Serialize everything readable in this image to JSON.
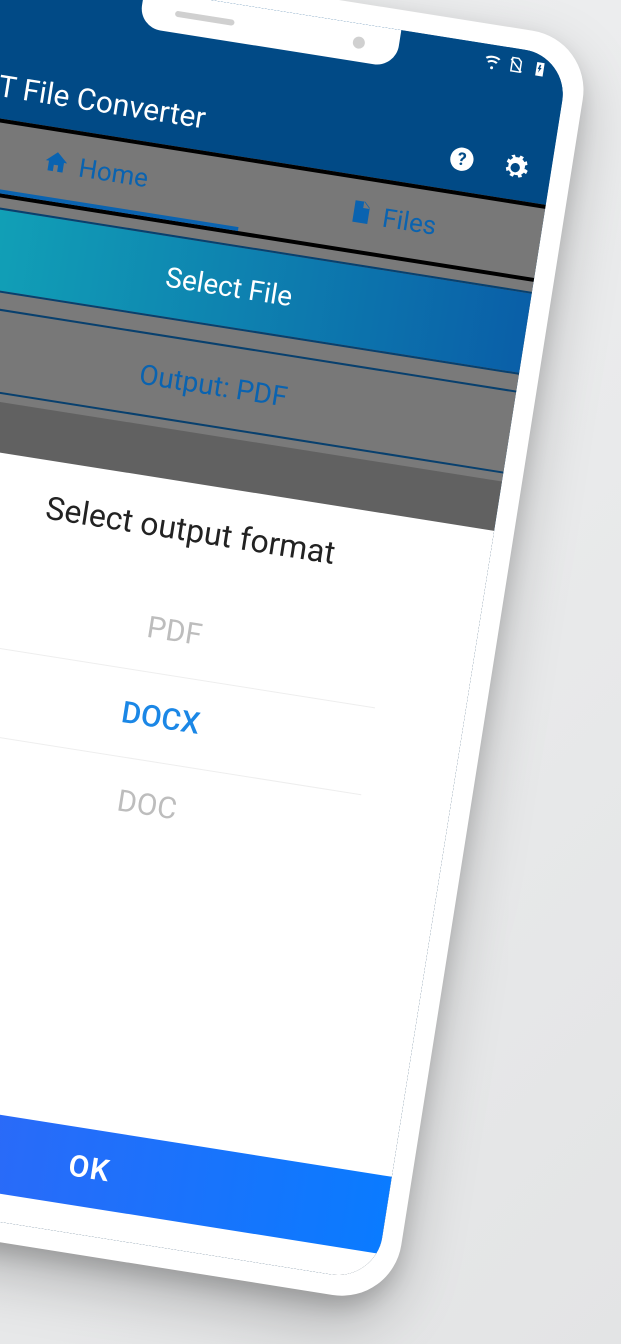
{
  "status": {
    "wifi": true,
    "battery_charging": true,
    "signal_off": true
  },
  "appbar": {
    "title": "PT File Converter",
    "help_icon": "help-icon",
    "settings_icon": "settings-icon"
  },
  "tabs": [
    {
      "label": "Home",
      "icon": "home-icon",
      "active": true
    },
    {
      "label": "Files",
      "icon": "file-icon",
      "active": false
    }
  ],
  "buttons": {
    "select_file": "Select File",
    "output": "Output: PDF"
  },
  "dialog": {
    "title": "Select output format",
    "options": [
      "PDF",
      "DOCX",
      "DOC"
    ],
    "selected_index": 1,
    "ok": "OK"
  }
}
